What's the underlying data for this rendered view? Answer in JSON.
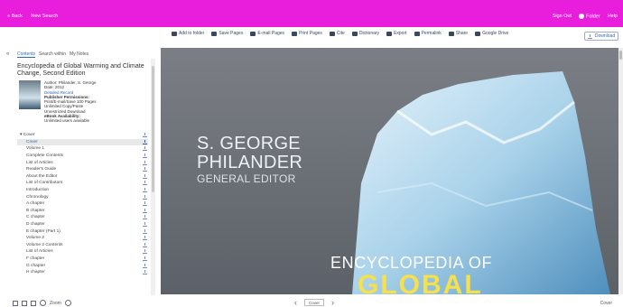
{
  "topbar": {
    "back": "« Back",
    "new_search": "New Search",
    "sign_out": "Sign Out",
    "folder": "Folder",
    "help": "Help"
  },
  "toolbar": {
    "items": [
      "Add to folder",
      "Save Pages",
      "E-mail Pages",
      "Print Pages",
      "Cite",
      "Dictionary",
      "Export",
      "Permalink",
      "Share",
      "Google Drive"
    ],
    "download": "Download"
  },
  "sidebar": {
    "tabs": [
      "Contents",
      "Search within",
      "My Notes"
    ],
    "book": {
      "title": "Encyclopedia of Global Warming and Climate Change, Second Edition",
      "author": "Author: Philander, S. George",
      "date": "Date: 2012",
      "details_link": "Detailed Record",
      "permissions_label": "Publisher Permissions:",
      "permissions": [
        "Print/E-mail/Save 100 Pages",
        "Unlimited Copy/Paste",
        "Unrestricted Download"
      ],
      "availability_label": "eBook Availability:",
      "availability": "Unlimited users available"
    },
    "toc_header": "Cover",
    "toc": [
      "Cover",
      "Volume 1",
      "Complete Contents",
      "List of Articles",
      "Reader's Guide",
      "About the Editor",
      "List of Contributors",
      "Introduction",
      "Chronology",
      "A chapter",
      "B chapter",
      "C chapter",
      "D chapter",
      "E chapter (Part 1)",
      "Volume 2",
      "Volume 2 Contents",
      "List of Articles",
      "F chapter",
      "G chapter",
      "H chapter"
    ],
    "toc_selected": 0
  },
  "cover": {
    "author_first": "S. GEORGE",
    "author_last": "PHILANDER",
    "role": "GENERAL EDITOR",
    "title": "ENCYCLOPEDIA OF",
    "title_big": "GLOBAL"
  },
  "bottom": {
    "zoom": "Zoom",
    "page": "Cover",
    "page_right": "Cover"
  },
  "colors": {
    "brand": "#e91edc",
    "link": "#2a6ab8"
  }
}
